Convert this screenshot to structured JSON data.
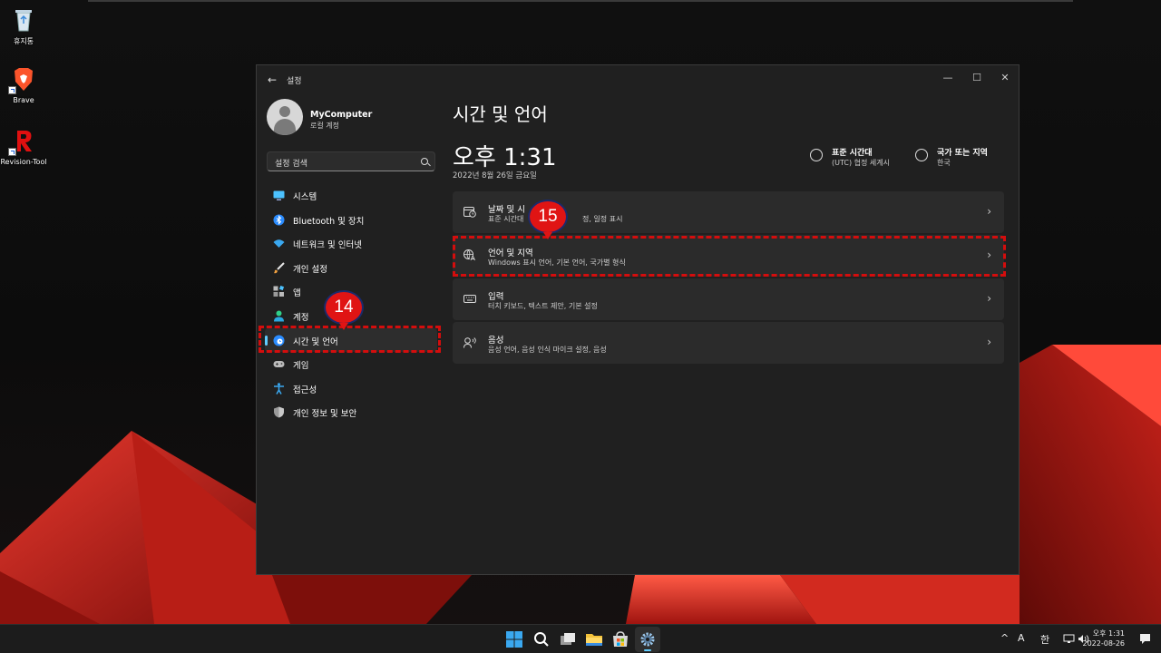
{
  "desktop": {
    "icons": [
      {
        "label": "휴지통"
      },
      {
        "label": "Brave"
      },
      {
        "label": "Revision-Tool"
      }
    ]
  },
  "window": {
    "title": "설정",
    "controls": {
      "minimize": "—",
      "maximize": "☐",
      "close": "✕"
    }
  },
  "profile": {
    "name": "MyComputer",
    "type": "로컬 계정"
  },
  "search": {
    "placeholder": "설정 검색"
  },
  "nav": [
    {
      "label": "시스템",
      "icon": "monitor-icon"
    },
    {
      "label": "Bluetooth 및 장치",
      "icon": "bluetooth-icon"
    },
    {
      "label": "네트워크 및 인터넷",
      "icon": "wifi-icon"
    },
    {
      "label": "개인 설정",
      "icon": "brush-icon"
    },
    {
      "label": "앱",
      "icon": "apps-icon"
    },
    {
      "label": "계정",
      "icon": "person-icon"
    },
    {
      "label": "시간 및 언어",
      "icon": "globe-clock-icon",
      "active": true
    },
    {
      "label": "게임",
      "icon": "gamepad-icon"
    },
    {
      "label": "접근성",
      "icon": "accessibility-icon"
    },
    {
      "label": "개인 정보 및 보안",
      "icon": "shield-icon"
    }
  ],
  "main": {
    "title": "시간 및 언어",
    "clock": "오후 1:31",
    "date": "2022년 8월 26일 금요일",
    "timezone": {
      "title": "표준 시간대",
      "value": "(UTC) 협정 세계시"
    },
    "region": {
      "title": "국가 또는 지역",
      "value": "한국"
    },
    "cards": [
      {
        "title": "날짜 및 시",
        "subtitle": "표준 시간대",
        "subtitle_tail": "정, 일정 표시",
        "icon": "calendar-clock-icon"
      },
      {
        "title": "언어 및 지역",
        "subtitle": "Windows 표시 언어, 기본 언어, 국가별 형식",
        "icon": "language-icon"
      },
      {
        "title": "입력",
        "subtitle": "터치 키보드, 텍스트 제안, 기본 설정",
        "icon": "keyboard-icon"
      },
      {
        "title": "음성",
        "subtitle": "음성 언어, 음성 인식 마이크 설정, 음성",
        "icon": "speech-icon"
      }
    ]
  },
  "annotations": {
    "step1": "14",
    "step2": "15"
  },
  "taskbar": {
    "tray_ime_mode": "A",
    "tray_ime_lang": "한",
    "time": "오후 1:31",
    "date": "2022-08-26"
  },
  "colors": {
    "accent": "#60cdff",
    "annotation": "#d40d0d"
  }
}
